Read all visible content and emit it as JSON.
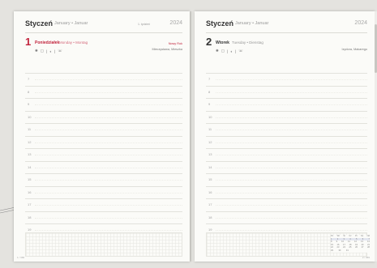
{
  "left_page": {
    "month": "Styczeń",
    "month_sub": "January • Januar",
    "week_label": "1. tydzień",
    "year": "2024",
    "day_number": "1",
    "day_name": "Poniedziałek",
    "day_sub": "Monday • Montag",
    "accent_color": "#c2243d",
    "note_line1": "Nowy Rok",
    "note_line2": "Mieczysława, Mieszka",
    "footer": "1 / 366"
  },
  "right_page": {
    "month": "Styczeń",
    "month_sub": "January • Januar",
    "year": "2024",
    "day_number": "2",
    "day_name": "Wtorek",
    "day_sub": "Tuesday • Dienstag",
    "accent_color": "#333333",
    "note_line1": "Izydora, Makarego",
    "footer": "2 / 365"
  },
  "hours": [
    "7",
    "8",
    "9",
    "10",
    "11",
    "12",
    "13",
    "14",
    "15",
    "16",
    "17",
    "18",
    "19"
  ],
  "mini_calendar": {
    "header": [
      "Pn",
      "Wt",
      "Śr",
      "Cz",
      "Pt",
      "So",
      "Nd"
    ],
    "weeks": [
      [
        "1",
        "2",
        "3",
        "4",
        "5",
        "6",
        "7"
      ],
      [
        "8",
        "9",
        "10",
        "11",
        "12",
        "13",
        "14"
      ],
      [
        "15",
        "16",
        "17",
        "18",
        "19",
        "20",
        "21"
      ],
      [
        "22",
        "23",
        "24",
        "25",
        "26",
        "27",
        "28"
      ],
      [
        "29",
        "30",
        "31",
        "",
        "",
        "",
        ""
      ]
    ]
  }
}
